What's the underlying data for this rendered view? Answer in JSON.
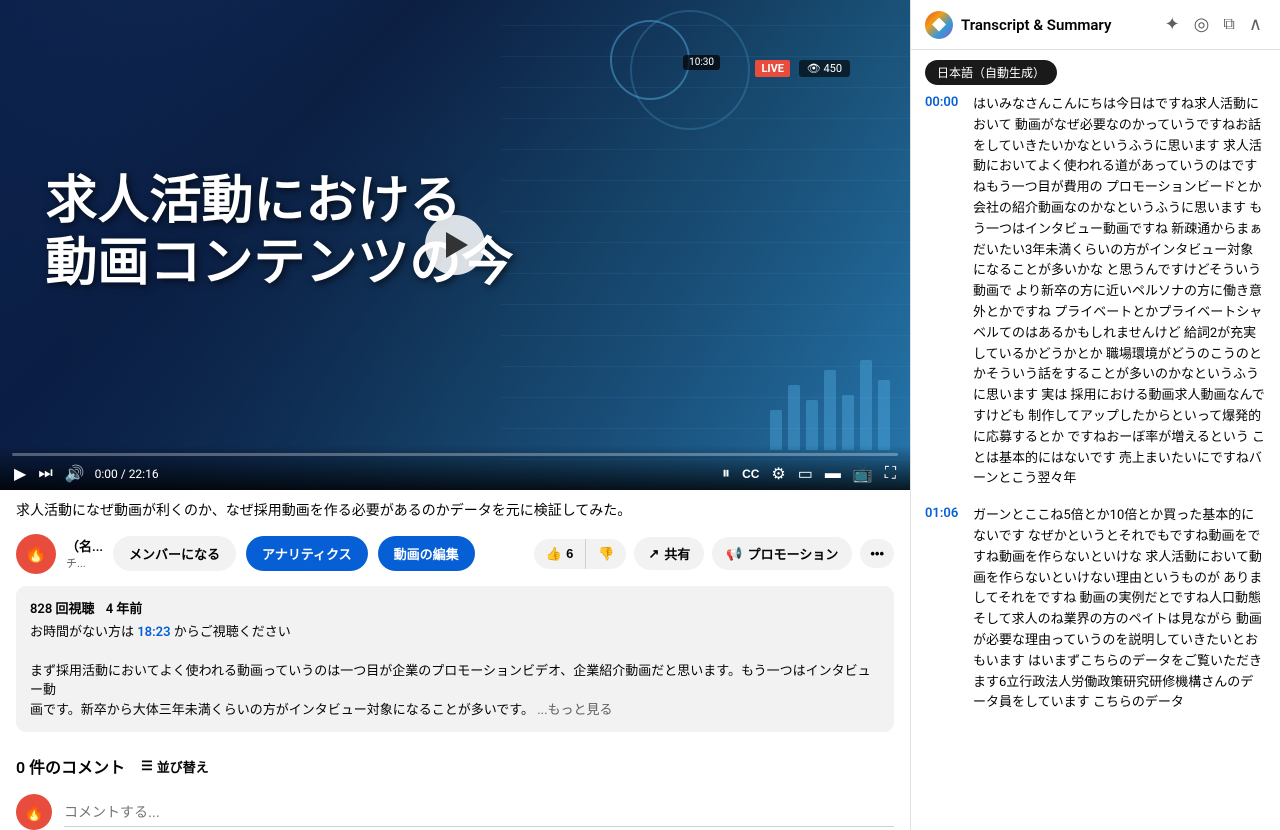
{
  "header": {
    "panel_title": "Transcript & Summary",
    "lang_badge": "日本語（自動生成）"
  },
  "video": {
    "title_line1": "求人活動における",
    "title_line2": "動画コンテンツの今",
    "description": "求人活動になぜ動画が利くのか、なぜ採用動画を作る必要があるのかデータを元に検証してみた。",
    "duration": "22:16",
    "current_time": "0:00",
    "views": "828 回視聴",
    "upload_date": "4 年前",
    "live_label": "LIVE",
    "view_count": "450",
    "time_code": "10:30"
  },
  "channel": {
    "name": "（名...",
    "name_short": "チ...",
    "icon_char": "🔥"
  },
  "buttons": {
    "member": "メンバーになる",
    "analytics": "アナリティクス",
    "edit": "動画の編集",
    "like_count": "6",
    "share": "共有",
    "promote": "プロモーション"
  },
  "video_body": {
    "timestamp1": "18:23",
    "intro": "お時間がない方は",
    "intro_after": " からご視聴ください",
    "line1": "まず採用活動においてよく使われる動画っていうのは一つ目が企業のプロモーションビデオ、企業紹介動画だと思います。もう一つはインタビュー動",
    "line2": "画です。新卒から大体三年未満くらいの方がインタビュー対象になることが多いです。",
    "more": "...もっと見る"
  },
  "comments": {
    "count": "0 件のコメント",
    "sort_label": "並び替え",
    "placeholder": "コメントする..."
  },
  "transcript": [
    {
      "time": "00:00",
      "text": "はいみなさんこんにちは今日はですね求人活動において 動画がなぜ必要なのかっていうですねお話をしていきたいかなというふうに思います 求人活動においてよく使われる道があっていうのはですねもう一つ目が費用の プロモーションビードとか会社の紹介動画なのかなというふうに思います もう一つはインタビュー動画ですね 新疎通からまぁだいたい3年未満くらいの方がインタビュー対象になることが多いかな と思うんですけどそういう動画で より新卒の方に近いペルソナの方に働き意外とかですね プライベートとかプライベートシャベルてのはあるかもしれませんけど 給詞2が充実しているかどうかとか 職場環境がどうのこうのとかそういう話をすることが多いのかなというふうに思います 実は 採用における動画求人動画なんですけども 制作してアップしたからといって爆発的に応募するとか ですねおーぼ率が増えるという ことは基本的にはないです 売上まいたいにですねバーンとこう翌々年"
    },
    {
      "time": "01:06",
      "text": "ガーンとここね5倍とか10倍とか買った基本的にないです なぜかというとそれでもですね動画をですね動画を作らないといけな 求人活動において動画を作らないといけない理由というものが ありましてそれをですね 動画の実例だとですね人口動態 そして求人のね業界の方のペイトは見ながら 動画が必要な理由っていうのを説明していきたいとおもいます はいまずこちらのデータをご覧いただきます6立行政法人労働政策研究研修機構さんのデータ員をしています こちらのデータ"
    }
  ],
  "icons": {
    "play": "▶",
    "pause": "⏸",
    "next": "⏭",
    "volume": "🔊",
    "settings": "⚙",
    "captions": "CC",
    "fullscreen": "⛶",
    "like": "👍",
    "dislike": "👎",
    "share_icon": "↗",
    "promote_icon": "📢",
    "more": "•••",
    "sort": "☰",
    "chevron_down": "▾",
    "close": "✕",
    "minimize": "−",
    "copy": "⧉",
    "ai": "✦",
    "settings2": "◎"
  }
}
